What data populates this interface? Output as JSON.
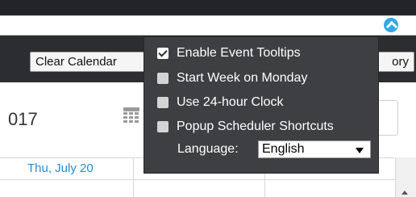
{
  "toolbar": {
    "clear_calendar_label": "Clear Calendar",
    "history_label": "ory"
  },
  "calendar": {
    "date_range_partial": "017",
    "day_headers": [
      "Thu, July 20"
    ]
  },
  "settings_menu": {
    "items": [
      {
        "label": "Enable Event Tooltips",
        "checked": true
      },
      {
        "label": "Start Week on Monday",
        "checked": false
      },
      {
        "label": "Use 24-hour Clock",
        "checked": false
      },
      {
        "label": "Popup Scheduler Shortcuts",
        "checked": false
      }
    ],
    "language_label": "Language:",
    "language_value": "English"
  },
  "icons": {
    "close": "close-icon",
    "collapse": "chevron-up-circle-icon",
    "calendar": "calendar-icon"
  },
  "colors": {
    "accent": "#2fa8e6",
    "menu_bg": "#3e3f42",
    "day_header_text": "#1f8fd6"
  }
}
